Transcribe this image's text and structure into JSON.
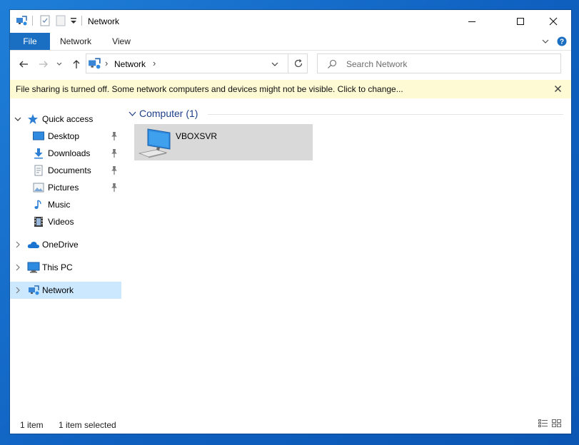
{
  "window": {
    "title": "Network"
  },
  "ribbon": {
    "tabs": [
      {
        "label": "File",
        "active": true
      },
      {
        "label": "Network"
      },
      {
        "label": "View"
      }
    ]
  },
  "address": {
    "crumb": "Network",
    "separator_left": "›",
    "separator_right": "›"
  },
  "search": {
    "placeholder": "Search Network"
  },
  "infobar": {
    "text": "File sharing is turned off. Some network computers and devices might not be visible. Click to change..."
  },
  "sidebar": {
    "items": [
      {
        "label": "Quick access",
        "icon": "star-icon",
        "expanded": true
      },
      {
        "label": "Desktop",
        "icon": "desktop-folder-icon",
        "pinned": true
      },
      {
        "label": "Downloads",
        "icon": "download-arrow-icon",
        "pinned": true
      },
      {
        "label": "Documents",
        "icon": "document-icon",
        "pinned": true
      },
      {
        "label": "Pictures",
        "icon": "pictures-icon",
        "pinned": true
      },
      {
        "label": "Music",
        "icon": "music-note-icon"
      },
      {
        "label": "Videos",
        "icon": "film-icon"
      },
      {
        "label": "OneDrive",
        "icon": "cloud-icon"
      },
      {
        "label": "This PC",
        "icon": "computer-monitor-icon"
      },
      {
        "label": "Network",
        "icon": "network-icon",
        "selected": true
      }
    ]
  },
  "content": {
    "group_title": "Computer (1)",
    "items": [
      {
        "label": "VBOXSVR",
        "icon": "computer-icon",
        "selected": true
      }
    ]
  },
  "status": {
    "count": "1 item",
    "selection": "1 item selected"
  },
  "colors": {
    "accent": "#1a6fc2",
    "selection": "#cce8ff",
    "infobar": "#fdfad4",
    "tile_selected": "#d9d9d9",
    "group_title": "#1e3f8a"
  }
}
